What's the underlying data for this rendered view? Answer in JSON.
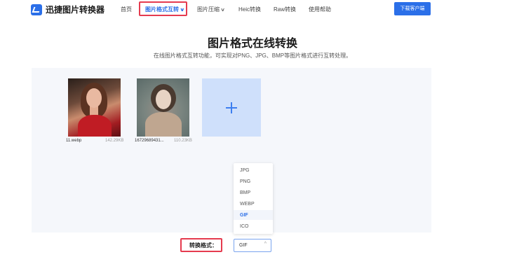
{
  "app": {
    "title": "迅捷图片转换器"
  },
  "nav": {
    "items": [
      {
        "label": "首页"
      },
      {
        "label": "图片格式互转",
        "has_dropdown": true,
        "active": true
      },
      {
        "label": "图片压缩",
        "has_dropdown": true
      },
      {
        "label": "Heic转换"
      },
      {
        "label": "Raw转换"
      },
      {
        "label": "使用帮助"
      }
    ],
    "download_label": "下载客户端"
  },
  "hero": {
    "title": "图片格式在线转换",
    "subtitle": "在线图片格式互转功能，可实现对PNG、JPG、BMP等图片格式进行互转处理。"
  },
  "files": [
    {
      "name": "11.webp",
      "size": "142.29KB"
    },
    {
      "name": "16729689431...",
      "size": "110.23KB"
    }
  ],
  "add_icon": "plus-icon",
  "format_options": [
    "JPG",
    "PNG",
    "BMP",
    "WEBP",
    "GIF",
    "ICO"
  ],
  "format_selected": "GIF",
  "format_label": "转换格式：",
  "colors": {
    "accent": "#2b6fe8",
    "highlight": "#e53b4f",
    "tile": "#cfe0fb"
  }
}
